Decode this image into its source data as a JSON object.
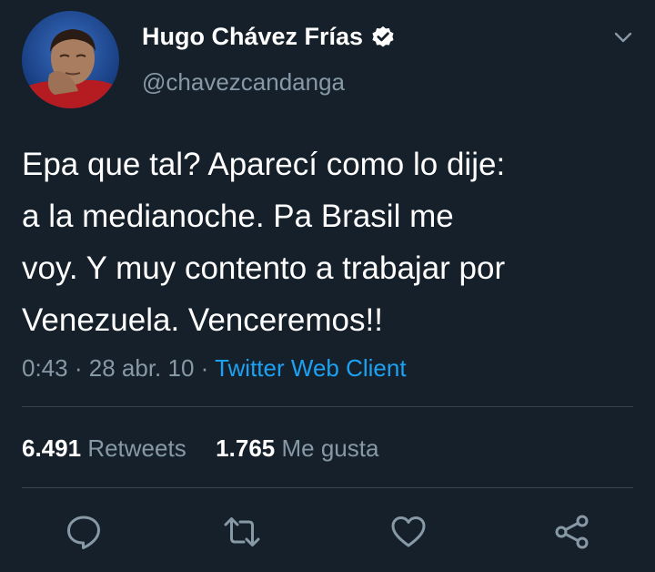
{
  "author": {
    "display_name": "Hugo Chávez Frías",
    "handle": "@chavezcandanga",
    "verified": true,
    "avatar_icon": "profile-photo"
  },
  "tweet": {
    "text": "Epa que tal? Aparecí como lo dije:\na la medianoche. Pa Brasil me\nvoy. Y muy contento a trabajar por\nVenezuela. Venceremos!!",
    "time": "0:43",
    "date": "28 abr. 10",
    "separator": "·",
    "client": "Twitter Web Client"
  },
  "stats": {
    "retweets_count": "6.491",
    "retweets_label": "Retweets",
    "likes_count": "1.765",
    "likes_label": "Me gusta"
  },
  "actions": [
    {
      "name": "reply",
      "icon": "speech-bubble-icon"
    },
    {
      "name": "retweet",
      "icon": "retweet-icon"
    },
    {
      "name": "like",
      "icon": "heart-icon"
    },
    {
      "name": "share",
      "icon": "share-icon"
    }
  ],
  "colors": {
    "background": "#15202b",
    "text_primary": "#ffffff",
    "text_secondary": "#8899a6",
    "accent": "#1da1f2",
    "divider": "#38444d"
  }
}
